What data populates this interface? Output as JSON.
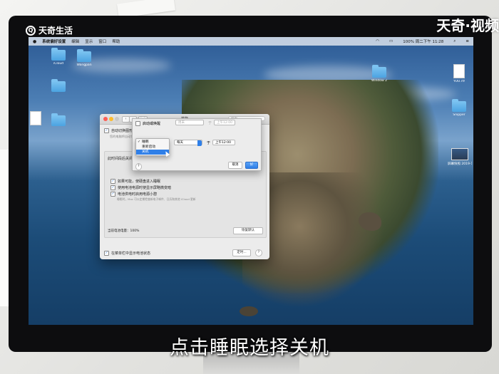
{
  "watermark": {
    "left": "天奇生活",
    "right": "天奇·视频"
  },
  "caption": "点击睡眠选择关机",
  "menubar": {
    "items": [
      "系统偏好设置",
      "编辑",
      "显示",
      "窗口",
      "帮助"
    ],
    "status": "100%  周二下午 11:28"
  },
  "desktop_icons": [
    {
      "label": "iCloud",
      "type": "folder"
    },
    {
      "label": "Wangpan",
      "type": "folder"
    },
    {
      "label": "",
      "type": "folder"
    },
    {
      "label": "",
      "type": "doc"
    },
    {
      "label": "",
      "type": "folder"
    },
    {
      "label": "Window 2",
      "type": "folder"
    },
    {
      "label": "YOU.rtf",
      "type": "doc"
    },
    {
      "label": "Snipper",
      "type": "folder"
    },
    {
      "label": "屏幕快照 2019-12-...",
      "type": "thumb"
    }
  ],
  "window": {
    "title": "节能",
    "search_placeholder": "搜索",
    "auto_switch_label": "自动切换图形卡",
    "auto_switch_desc": "您的电脑将自动切换图形卡...",
    "turn_off_label": "此时间段后关闭显示器",
    "opt1": "如果可能，使硬盘进入睡眠",
    "opt2": "使用电池电源时使显示屏略微变暗",
    "opt3": "电池供电时启用电源小憩",
    "opt3_desc": "睡眠时，Mac 可以定期检查新电子邮件、日历和其他 iCloud 更新",
    "battery_label": "当前电池电量：100%",
    "restore_button": "恢复默认",
    "show_status_label": "在菜单栏中显示电池状态",
    "schedule_button": "定时...",
    "help": "?"
  },
  "sheet": {
    "startup_label": "启动或唤醒",
    "startup_day": "周末",
    "startup_at": "于",
    "startup_time": "上午12:00",
    "action_day": "每天",
    "action_at": "于",
    "action_time": "上午12:00",
    "cancel": "取消",
    "ok": "好",
    "help": "?"
  },
  "menu": {
    "items": [
      {
        "label": "睡眠",
        "checked": true,
        "selected": false
      },
      {
        "label": "重新启动",
        "checked": false,
        "selected": false
      },
      {
        "label": "关机",
        "checked": false,
        "selected": true
      }
    ]
  }
}
